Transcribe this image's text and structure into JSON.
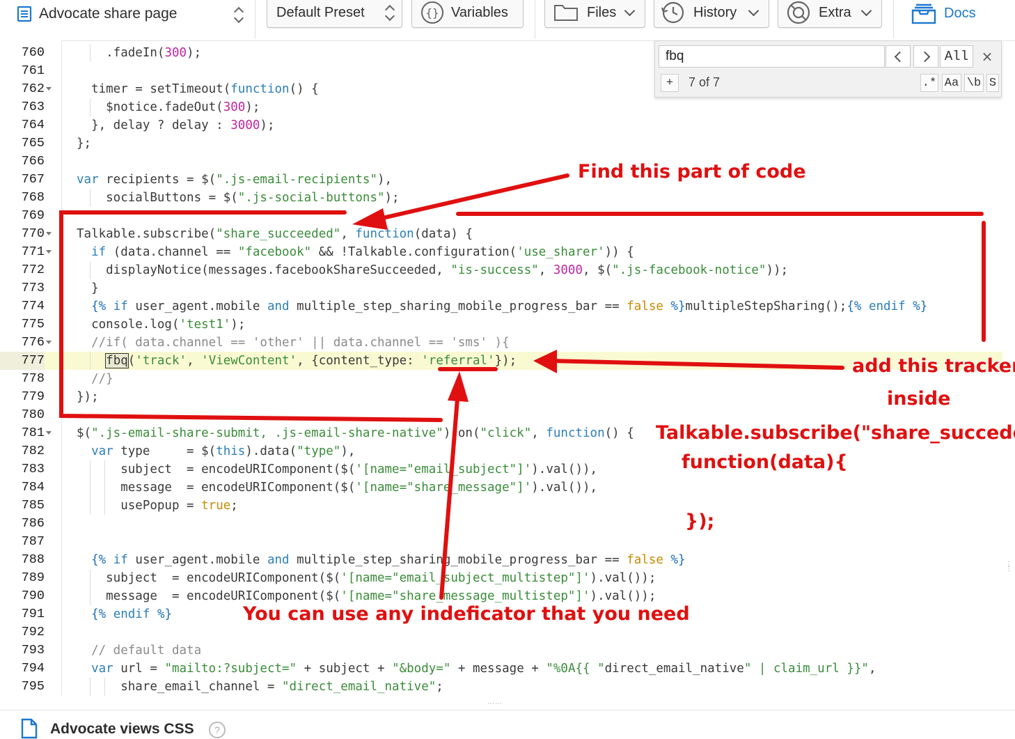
{
  "toolbar": {
    "page_select": "Advocate share page",
    "preset": "Default Preset",
    "variables": "Variables",
    "files": "Files",
    "history": "History",
    "extra": "Extra",
    "docs": "Docs"
  },
  "search": {
    "query": "fbq",
    "all_label": "All",
    "plus_label": "+",
    "count": "7 of 7",
    "options": [
      ".*",
      "Aa",
      "\\b",
      "S"
    ]
  },
  "code": {
    "active_line": "777",
    "lines": [
      {
        "n": "760",
        "text": "    .fadeIn(300);"
      },
      {
        "n": "761",
        "text": ""
      },
      {
        "n": "762",
        "text": "  timer = setTimeout(function() {"
      },
      {
        "n": "763",
        "text": "    $notice.fadeOut(300);"
      },
      {
        "n": "764",
        "text": "  }, delay ? delay : 3000);"
      },
      {
        "n": "765",
        "text": "};"
      },
      {
        "n": "766",
        "text": ""
      },
      {
        "n": "767",
        "text": "var recipients = $(\".js-email-recipients\"),"
      },
      {
        "n": "768",
        "text": "    socialButtons = $(\".js-social-buttons\");"
      },
      {
        "n": "769",
        "text": ""
      },
      {
        "n": "770",
        "text": "Talkable.subscribe(\"share_succeeded\", function(data) {"
      },
      {
        "n": "771",
        "text": "  if (data.channel == \"facebook\" && !Talkable.configuration('use_sharer')) {"
      },
      {
        "n": "772",
        "text": "    displayNotice(messages.facebookShareSucceeded, \"is-success\", 3000, $(\".js-facebook-notice\"));"
      },
      {
        "n": "773",
        "text": "  }"
      },
      {
        "n": "774",
        "text": "  {% if user_agent.mobile and multiple_step_sharing_mobile_progress_bar == false %}multipleStepSharing();{% endif %}"
      },
      {
        "n": "775",
        "text": "  console.log('test1');"
      },
      {
        "n": "776",
        "text": "  //if( data.channel == 'other' || data.channel == 'sms' ){"
      },
      {
        "n": "777",
        "text": "    fbq('track', 'ViewContent', {content_type: 'referral'});"
      },
      {
        "n": "778",
        "text": "  //}"
      },
      {
        "n": "779",
        "text": "});"
      },
      {
        "n": "780",
        "text": ""
      },
      {
        "n": "781",
        "text": "$(\".js-email-share-submit, .js-email-share-native\").on(\"click\", function() {"
      },
      {
        "n": "782",
        "text": "  var type     = $(this).data(\"type\"),"
      },
      {
        "n": "783",
        "text": "      subject  = encodeURIComponent($('[name=\"email_subject\"]').val()),"
      },
      {
        "n": "784",
        "text": "      message  = encodeURIComponent($('[name=\"share_message\"]').val()),"
      },
      {
        "n": "785",
        "text": "      usePopup = true;"
      },
      {
        "n": "786",
        "text": ""
      },
      {
        "n": "787",
        "text": ""
      },
      {
        "n": "788",
        "text": "  {% if user_agent.mobile and multiple_step_sharing_mobile_progress_bar == false %}"
      },
      {
        "n": "789",
        "text": "    subject  = encodeURIComponent($('[name=\"email_subject_multistep\"]').val());"
      },
      {
        "n": "790",
        "text": "    message  = encodeURIComponent($('[name=\"share_message_multistep\"]').val());"
      },
      {
        "n": "791",
        "text": "  {% endif %}"
      },
      {
        "n": "792",
        "text": ""
      },
      {
        "n": "793",
        "text": "  // default data"
      },
      {
        "n": "794",
        "text": "  var url = \"mailto:?subject=\" + subject + \"&body=\" + message + \"%0A{{ \"direct_email_native\" | claim_url }}\","
      },
      {
        "n": "795",
        "text": "      share_email_channel = \"direct_email_native\";"
      }
    ]
  },
  "annotations": {
    "find": "Find this part of code",
    "add_line1": "add this tracker",
    "add_line2": "inside",
    "subscribe_line1": "Talkable.subscribe(\"share_succeded\",",
    "subscribe_line2": "function(data){",
    "subscribe_line3": "});",
    "indicator": "You can use any indeficator that you need",
    "color": "#e01010"
  },
  "bottom": {
    "section_title": "Advocate views CSS",
    "help": "?"
  }
}
